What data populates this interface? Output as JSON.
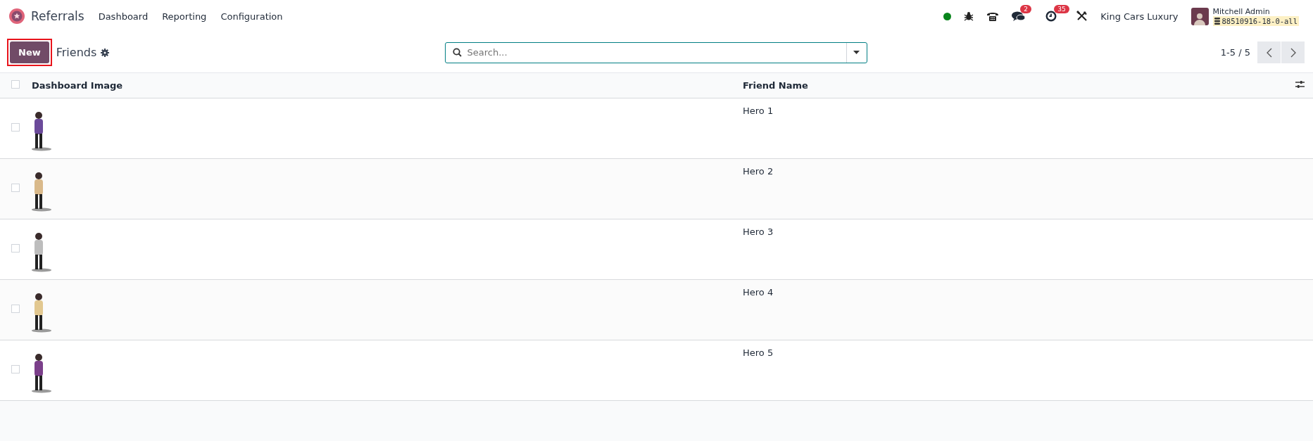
{
  "navbar": {
    "app_name": "Referrals",
    "menu": [
      "Dashboard",
      "Reporting",
      "Configuration"
    ],
    "messages_badge": "2",
    "activities_badge": "35",
    "company": "King Cars Luxury",
    "user_name": "Mitchell Admin",
    "database": "88510916-18-0-all"
  },
  "control_panel": {
    "new_button": "New",
    "new_button_highlighted": true,
    "title": "Friends",
    "search": {
      "placeholder": "Search..."
    },
    "pager": "1-5 / 5"
  },
  "table": {
    "select_all": false,
    "columns": [
      "Dashboard Image",
      "Friend Name"
    ],
    "rows": [
      {
        "friend_name": "Hero 1",
        "selected": false
      },
      {
        "friend_name": "Hero 2",
        "selected": false
      },
      {
        "friend_name": "Hero 3",
        "selected": false
      },
      {
        "friend_name": "Hero 4",
        "selected": false
      },
      {
        "friend_name": "Hero 5",
        "selected": false
      }
    ]
  }
}
